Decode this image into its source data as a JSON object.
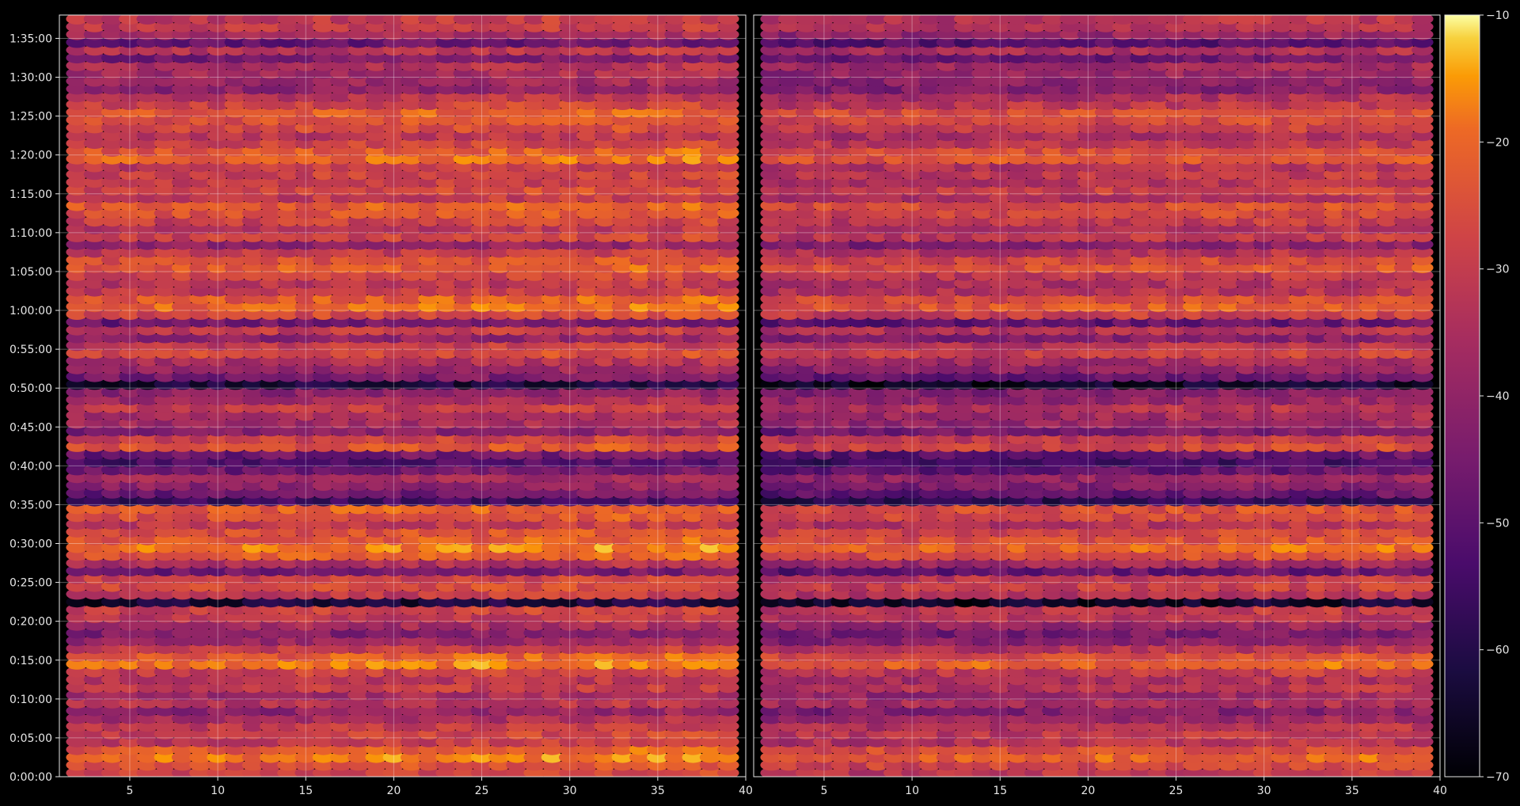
{
  "chart_data": {
    "type": "heatmap",
    "title": "",
    "xlabel": "",
    "ylabel": "",
    "colormap": "inferno",
    "background": "#000000",
    "grid": true,
    "legend": "none",
    "colorbar": {
      "position": "right",
      "min": -70,
      "max": -10,
      "ticks": [
        -70,
        -60,
        -50,
        -40,
        -30,
        -20,
        -10
      ],
      "tick_labels": [
        "−70",
        "−60",
        "−50",
        "−40",
        "−30",
        "−20",
        "−10"
      ]
    },
    "time_axis": {
      "min_seconds": 0,
      "max_seconds": 5880,
      "tick_labels": [
        "0:00:00",
        "0:05:00",
        "0:10:00",
        "0:15:00",
        "0:20:00",
        "0:25:00",
        "0:30:00",
        "0:35:00",
        "0:40:00",
        "0:45:00",
        "0:50:00",
        "0:55:00",
        "1:00:00",
        "1:05:00",
        "1:10:00",
        "1:15:00",
        "1:20:00",
        "1:25:00",
        "1:30:00",
        "1:35:00"
      ]
    },
    "panels": [
      {
        "name": "left",
        "xlim": [
          1,
          40
        ],
        "ticks": [
          5,
          10,
          15,
          20,
          25,
          30,
          35,
          40
        ],
        "tick_labels": [
          "5",
          "10",
          "15",
          "20",
          "25",
          "30",
          "35",
          "40"
        ]
      },
      {
        "name": "right",
        "xlim": [
          1,
          40
        ],
        "ticks": [
          5,
          10,
          15,
          20,
          25,
          30,
          35,
          40
        ],
        "tick_labels": [
          "5",
          "10",
          "15",
          "20",
          "25",
          "30",
          "35",
          "40"
        ]
      }
    ],
    "x_values": [
      2,
      3,
      4,
      5,
      6,
      7,
      8,
      9,
      10,
      11,
      12,
      13,
      14,
      15,
      16,
      17,
      18,
      19,
      20,
      21,
      22,
      23,
      24,
      25,
      26,
      27,
      28,
      29,
      30,
      31,
      32,
      33,
      34,
      35,
      36,
      37,
      38,
      39
    ],
    "row_interval_seconds": 60,
    "band_profile": {
      "description_minutes": "approximate level (dB) per minute row, 0..97",
      "levels": [
        -28,
        -24,
        -18,
        -22,
        -30,
        -28,
        -30,
        -35,
        -40,
        -32,
        -36,
        -30,
        -32,
        -28,
        -18,
        -22,
        -30,
        -38,
        -42,
        -36,
        -30,
        -28,
        -62,
        -30,
        -26,
        -28,
        -46,
        -34,
        -22,
        -18,
        -22,
        -24,
        -30,
        -24,
        -22,
        -55,
        -46,
        -40,
        -36,
        -46,
        -52,
        -46,
        -24,
        -28,
        -42,
        -36,
        -34,
        -30,
        -36,
        -40,
        -62,
        -44,
        -38,
        -34,
        -26,
        -30,
        -40,
        -30,
        -46,
        -26,
        -20,
        -22,
        -30,
        -32,
        -28,
        -22,
        -24,
        -30,
        -40,
        -28,
        -32,
        -28,
        -24,
        -22,
        -30,
        -26,
        -30,
        -28,
        -30,
        -20,
        -22,
        -28,
        -32,
        -26,
        -24,
        -22,
        -28,
        -32,
        -40,
        -38,
        -36,
        -34,
        -44,
        -32,
        -48,
        -36,
        -30,
        -30
      ]
    }
  }
}
